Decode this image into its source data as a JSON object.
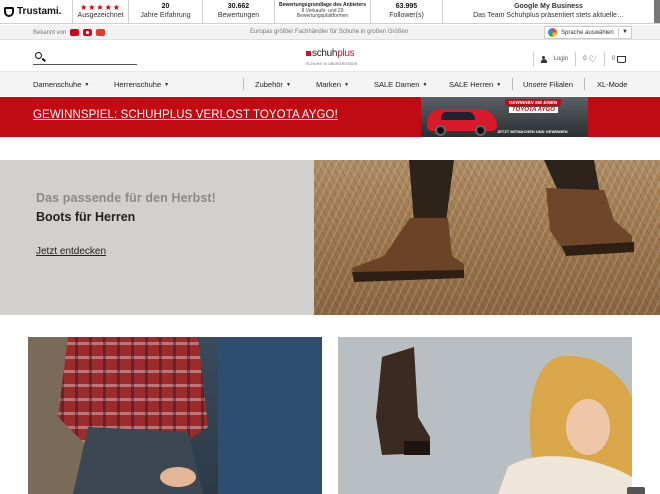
{
  "trust": {
    "logo": "Trustami.",
    "rating_stars": "★★★★★",
    "rating_label": "Ausgezeichnet",
    "experience_value": "20",
    "experience_label": "Jahre Erfahrung",
    "reviews_value": "30.662",
    "reviews_label": "Bewertungen",
    "basis_title": "Bewertungsgrundlage des Anbieters",
    "basis_line1": "8 Verkaufs- und 29",
    "basis_line2": "Bewertungsplattformen",
    "followers_value": "63.995",
    "followers_label": "Follower(s)",
    "gmb_title": "Google My Business",
    "gmb_text": "Das Team Schuhplus präsentiert stets aktuelle…"
  },
  "meta": {
    "known_from": "Bekannt von",
    "claim": "Europas größter Fachhändler für Schuhe in großen Größen",
    "language_label": "Sprache auswählen",
    "language_caret": "▼"
  },
  "header": {
    "brand_prefix": "schuh",
    "brand_suffix": "plus",
    "brand_tagline": "SCHUHE IN ÜBERGRÖSSEN",
    "login_label": "Login",
    "wishlist_count": "0",
    "cart_count": "0"
  },
  "nav": {
    "items": [
      {
        "label": "Damenschuhe",
        "dropdown": true
      },
      {
        "label": "Herrenschuhe",
        "dropdown": true
      },
      {
        "label": "Zubehör",
        "dropdown": true
      },
      {
        "label": "Marken",
        "dropdown": true
      },
      {
        "label": "SALE Damen",
        "dropdown": true
      },
      {
        "label": "SALE Herren",
        "dropdown": true
      },
      {
        "label": "Unsere Filialen",
        "dropdown": false
      },
      {
        "label": "XL-Mode",
        "dropdown": false
      }
    ],
    "dropdown_glyph": "▼"
  },
  "promo": {
    "link_text": "GEWINNSPIEL: SCHUHPLUS VERLOST TOYOTA AYGO!",
    "ad_headline": "GEWINNEN SIE EINEN",
    "ad_model": "TOYOTA AYGO",
    "ad_cta": "JETZT MITMACHEN UND GEWINNEN"
  },
  "hero": {
    "kicker": "Das passende für den Herbst!",
    "headline": "Boots für Herren",
    "cta": "Jetzt entdecken"
  },
  "colors": {
    "brand_red": "#c8102e",
    "promo_red": "#c00a14",
    "hero_panel": "#d2d0cf"
  }
}
